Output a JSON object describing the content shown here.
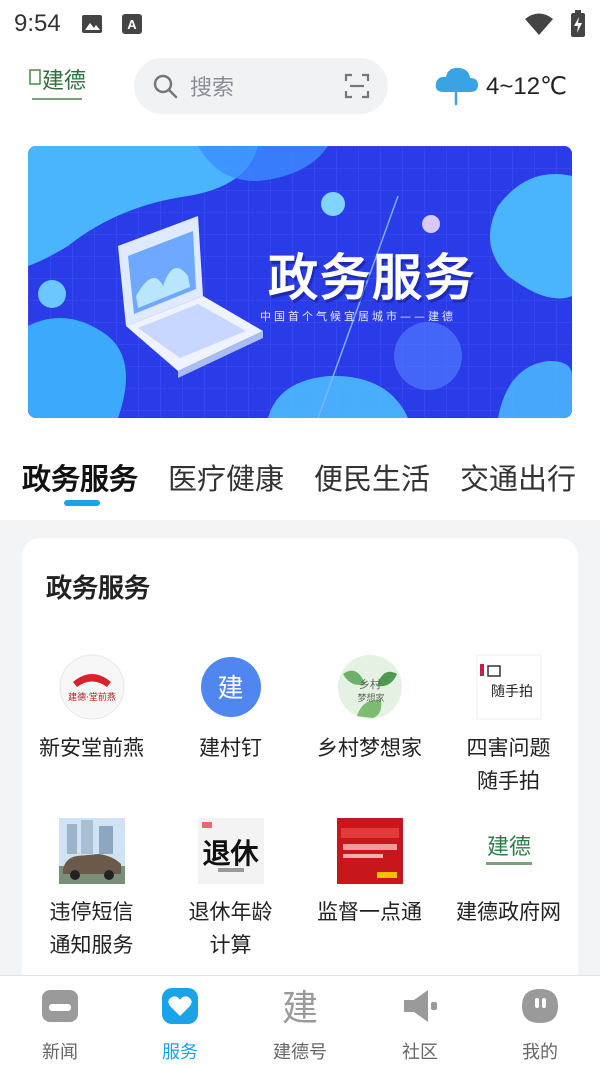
{
  "status_bar": {
    "time": "9:54"
  },
  "header": {
    "search_placeholder": "搜索",
    "weather": {
      "icon": "cloud-rain-icon",
      "temp": "4~12℃"
    }
  },
  "banner": {
    "title": "政务服务",
    "subtitle": "中国首个气候宜居城市——建德"
  },
  "tabs": [
    {
      "label": "政务服务",
      "active": true
    },
    {
      "label": "医疗健康",
      "active": false
    },
    {
      "label": "便民生活",
      "active": false
    },
    {
      "label": "交通出行",
      "active": false
    }
  ],
  "section": {
    "title": "政务服务",
    "items": [
      {
        "label": "新安堂前燕",
        "icon": "xinantang-logo-icon"
      },
      {
        "label": "建村钉",
        "icon": "jian-circle-icon",
        "icon_text": "建"
      },
      {
        "label": "乡村梦想家",
        "icon": "village-dream-icon"
      },
      {
        "label": "四害问题\n随手拍",
        "label_line1": "四害问题",
        "label_line2": "随手拍",
        "icon": "snapshot-icon"
      },
      {
        "label": "违停短信\n通知服务",
        "label_line1": "违停短信",
        "label_line2": "通知服务",
        "icon": "car-photo-icon"
      },
      {
        "label": "退休年龄\n计算",
        "label_line1": "退休年龄",
        "label_line2": "计算",
        "icon": "retire-calc-icon",
        "icon_text": "退休"
      },
      {
        "label": "监督一点通",
        "icon": "supervision-icon"
      },
      {
        "label": "建德政府网",
        "icon": "jiande-gov-icon"
      }
    ]
  },
  "bottom_nav": [
    {
      "label": "新闻",
      "icon": "news-icon",
      "active": false
    },
    {
      "label": "服务",
      "icon": "heart-service-icon",
      "active": true
    },
    {
      "label": "建德号",
      "icon": "jiande-calligraphy-icon",
      "active": false
    },
    {
      "label": "社区",
      "icon": "megaphone-icon",
      "active": false
    },
    {
      "label": "我的",
      "icon": "profile-icon",
      "active": false
    }
  ],
  "colors": {
    "accent": "#1aa3e8",
    "banner_bg": "#2a3be8"
  }
}
